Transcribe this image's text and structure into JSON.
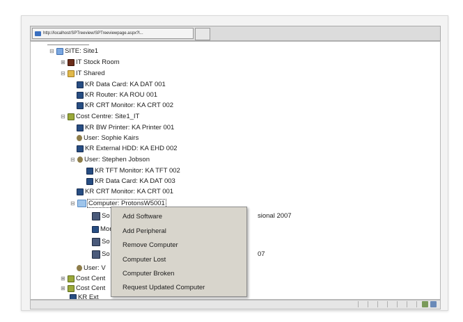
{
  "browser": {
    "tab_title": "http://localhost/SPTreeview/SPTreeviewpage.aspx?l..."
  },
  "tree": {
    "rows": [
      {
        "label": "SITE: Site1"
      },
      {
        "label": "IT Stock Room"
      },
      {
        "label": "IT Shared"
      },
      {
        "label": "KR Data Card: KA DAT 001"
      },
      {
        "label": "KR Router: KA ROU 001"
      },
      {
        "label": "KR CRT Monitor: KA CRT 002"
      },
      {
        "label": "Cost Centre: Site1_IT"
      },
      {
        "label": "KR BW Printer: KA Printer 001"
      },
      {
        "label": "User: Sophie Kairs"
      },
      {
        "label": "KR External HDD: KA EHD 002"
      },
      {
        "label": "User: Stephen Jobson"
      },
      {
        "label": "KR TFT Monitor: KA TFT 002"
      },
      {
        "label": "KR Data Card: KA DAT 003"
      },
      {
        "label": "KR CRT Monitor: KA CRT 001"
      },
      {
        "label": "Computer: ProtonsW5001"
      },
      {
        "label": "So",
        "tail": "sional 2007"
      },
      {
        "label": "Mon"
      },
      {
        "label": "So"
      },
      {
        "label": "So",
        "tail": "07"
      },
      {
        "label": "User: V"
      },
      {
        "label": "Cost Cent"
      },
      {
        "label": "Cost Cent"
      },
      {
        "label": "KR Ext"
      }
    ]
  },
  "context_menu": {
    "items": [
      "Add Software",
      "Add Peripheral",
      "Remove Computer",
      "Computer Lost",
      "Computer Broken",
      "Request Updated Computer"
    ]
  }
}
